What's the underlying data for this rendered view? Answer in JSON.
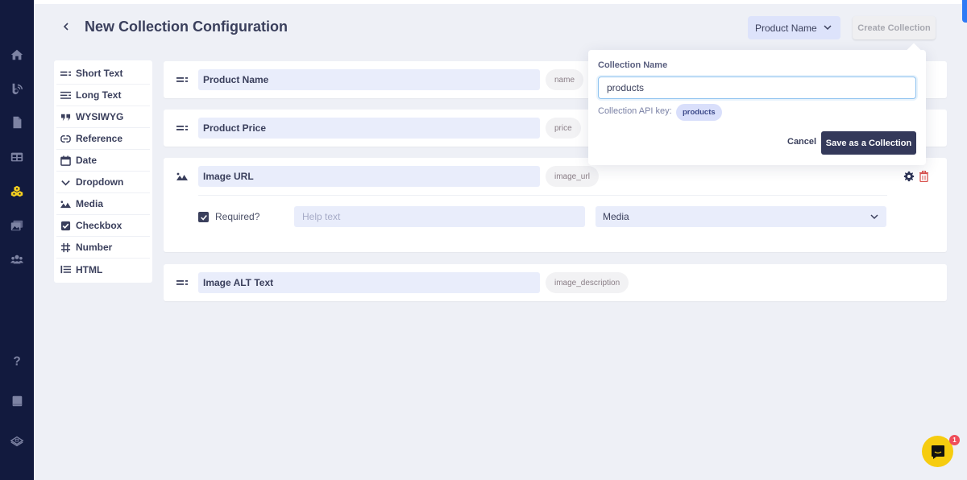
{
  "header": {
    "back_icon": "chevron-left-icon",
    "title": "New Collection Configuration",
    "field_select": {
      "value": "Product Name",
      "icon": "chevron-down-icon"
    },
    "create_button": "Create Collection"
  },
  "sidebar": {
    "items": [
      {
        "name": "home",
        "icon": "home-icon"
      },
      {
        "name": "blog",
        "icon": "blog-icon"
      },
      {
        "name": "pages",
        "icon": "document-icon"
      },
      {
        "name": "layouts",
        "icon": "grid-icon"
      },
      {
        "name": "collections",
        "icon": "cubes-icon",
        "active": true
      },
      {
        "name": "media",
        "icon": "images-icon"
      },
      {
        "name": "users",
        "icon": "users-icon"
      },
      {
        "name": "help",
        "icon": "question-icon"
      },
      {
        "name": "docs",
        "icon": "book-icon"
      },
      {
        "name": "plans",
        "icon": "layers-icon"
      }
    ],
    "active_color": "#f5cf1f"
  },
  "field_types": [
    {
      "label": "Short Text",
      "icon": "short-text-icon"
    },
    {
      "label": "Long Text",
      "icon": "long-text-icon"
    },
    {
      "label": "WYSIWYG",
      "icon": "quote-icon"
    },
    {
      "label": "Reference",
      "icon": "link-icon"
    },
    {
      "label": "Date",
      "icon": "calendar-icon"
    },
    {
      "label": "Dropdown",
      "icon": "chevron-down-icon"
    },
    {
      "label": "Media",
      "icon": "image-icon"
    },
    {
      "label": "Checkbox",
      "icon": "checkbox-icon"
    },
    {
      "label": "Number",
      "icon": "hash-icon"
    },
    {
      "label": "HTML",
      "icon": "list-icon"
    }
  ],
  "fields": [
    {
      "label": "Product Name",
      "key": "name",
      "icon": "short-text-icon"
    },
    {
      "label": "Product Price",
      "key": "price",
      "icon": "short-text-icon"
    },
    {
      "label": "Image URL",
      "key": "image_url",
      "icon": "image-icon",
      "expanded": true,
      "required_label": "Required?",
      "required": true,
      "help_placeholder": "Help text",
      "help_value": "",
      "type_value": "Media"
    },
    {
      "label": "Image ALT Text",
      "key": "image_description",
      "icon": "short-text-icon"
    }
  ],
  "popover": {
    "name_label": "Collection Name",
    "name_value": "products",
    "api_key_label": "Collection API key:",
    "api_key_value": "products",
    "cancel": "Cancel",
    "save": "Save as a Collection"
  },
  "chat": {
    "icon": "chat-icon",
    "badge": "1"
  },
  "colors": {
    "sidebar_bg": "#121a3e",
    "primary": "#34395a",
    "accent": "#f6cc0f",
    "danger": "#d9534f"
  }
}
